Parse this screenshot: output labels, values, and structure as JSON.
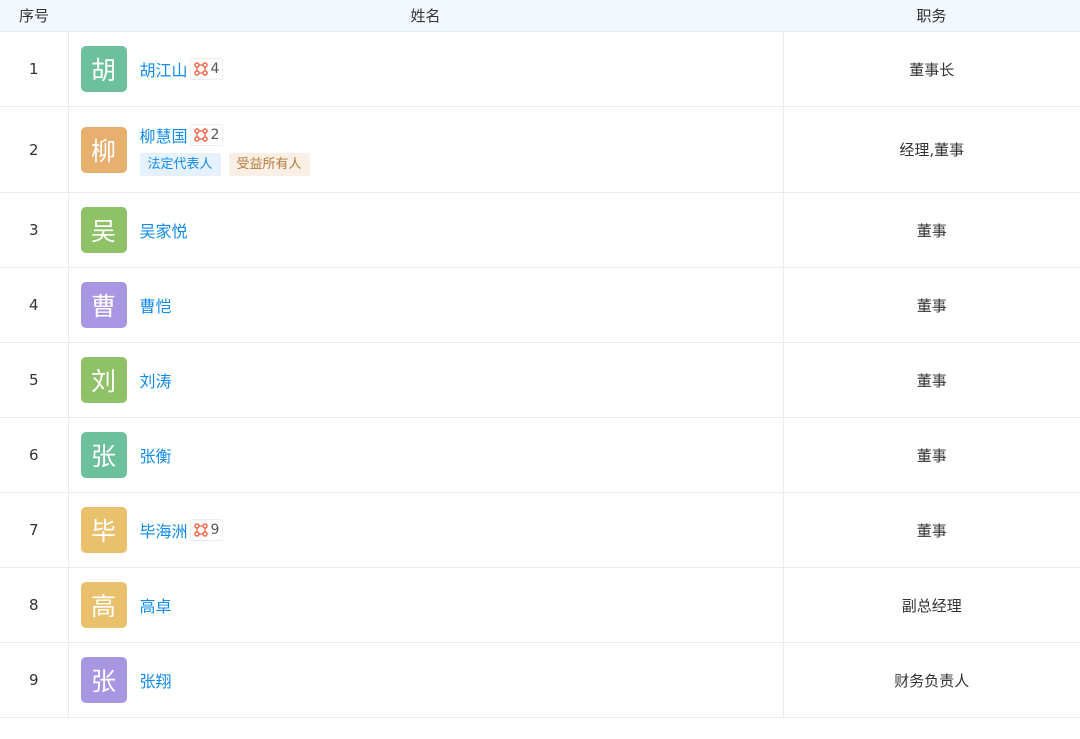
{
  "header": {
    "col_index": "序号",
    "col_name": "姓名",
    "col_role": "职务"
  },
  "colors": {
    "link": "#128bed",
    "header_bg": "#f2f8fe",
    "relation_icon": "#f06a4a"
  },
  "rows": [
    {
      "index": "1",
      "avatar_char": "胡",
      "avatar_color": "#6cc19c",
      "name": "胡江山",
      "relation_count": "4",
      "role": "董事长",
      "tags": []
    },
    {
      "index": "2",
      "avatar_char": "柳",
      "avatar_color": "#e8b06e",
      "name": "柳慧国",
      "relation_count": "2",
      "role": "经理,董事",
      "tags": [
        "法定代表人",
        "受益所有人"
      ]
    },
    {
      "index": "3",
      "avatar_char": "吴",
      "avatar_color": "#8fc167",
      "name": "吴家悦",
      "relation_count": "",
      "role": "董事",
      "tags": []
    },
    {
      "index": "4",
      "avatar_char": "曹",
      "avatar_color": "#a996e2",
      "name": "曹恺",
      "relation_count": "",
      "role": "董事",
      "tags": []
    },
    {
      "index": "5",
      "avatar_char": "刘",
      "avatar_color": "#8fc167",
      "name": "刘涛",
      "relation_count": "",
      "role": "董事",
      "tags": []
    },
    {
      "index": "6",
      "avatar_char": "张",
      "avatar_color": "#6cc19c",
      "name": "张衡",
      "relation_count": "",
      "role": "董事",
      "tags": []
    },
    {
      "index": "7",
      "avatar_char": "毕",
      "avatar_color": "#e9c06b",
      "name": "毕海洲",
      "relation_count": "9",
      "role": "董事",
      "tags": []
    },
    {
      "index": "8",
      "avatar_char": "高",
      "avatar_color": "#e9c06b",
      "name": "高卓",
      "relation_count": "",
      "role": "副总经理",
      "tags": []
    },
    {
      "index": "9",
      "avatar_char": "张",
      "avatar_color": "#a996e2",
      "name": "张翔",
      "relation_count": "",
      "role": "财务负责人",
      "tags": []
    }
  ]
}
